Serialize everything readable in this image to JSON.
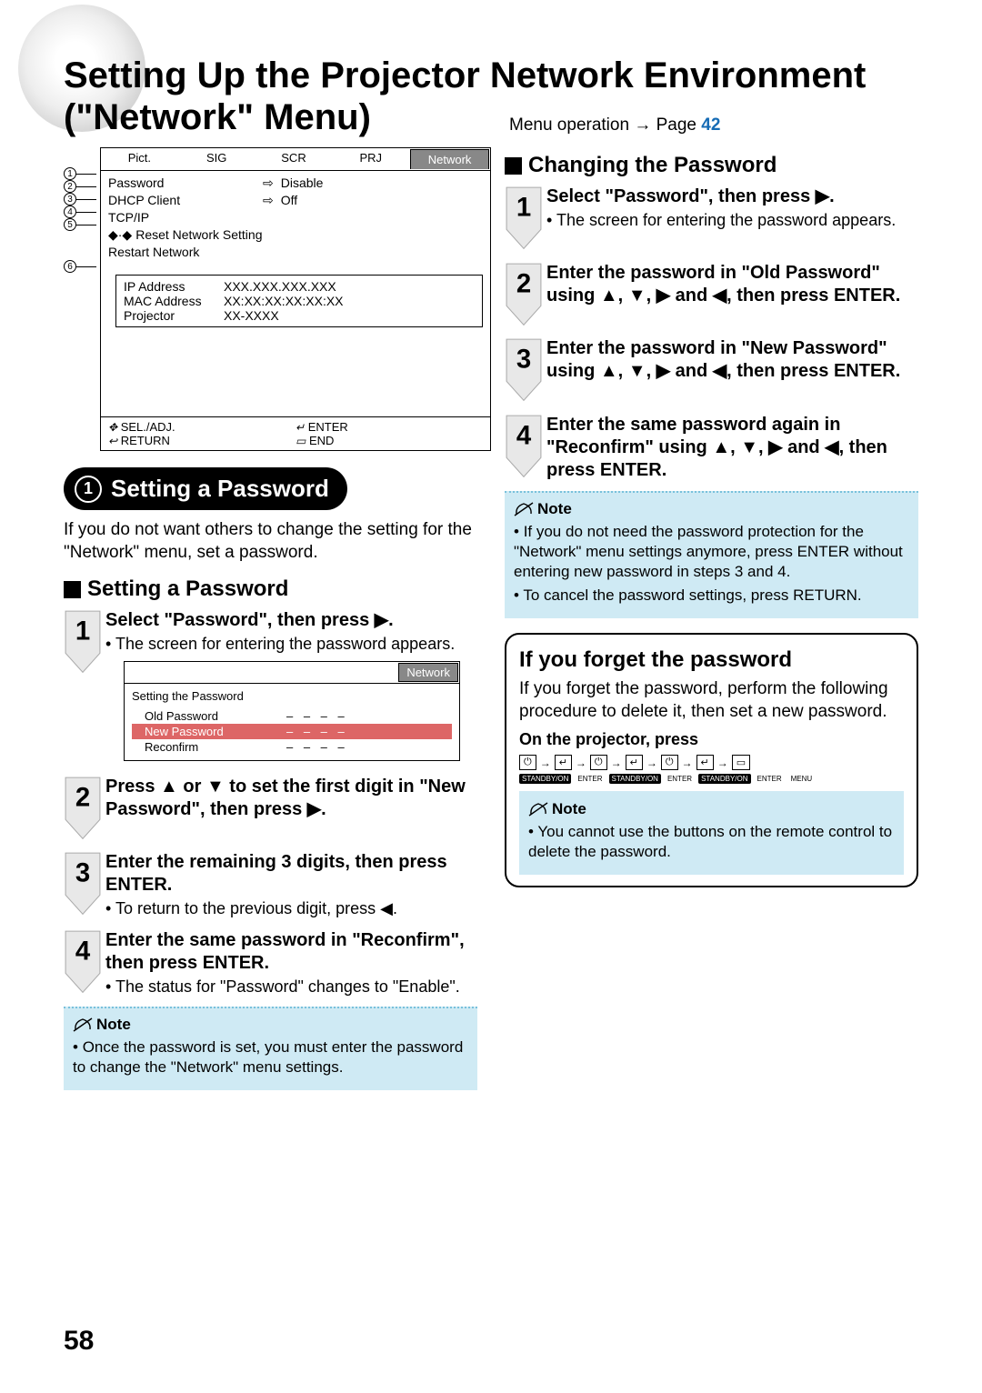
{
  "page": {
    "title": "Setting Up the Projector Network Environment (\"Network\" Menu)",
    "menu_op_prefix": "Menu operation ",
    "menu_op_page": "Page ",
    "menu_op_num": "42",
    "number": "58"
  },
  "osd": {
    "tabs": [
      "Pict.",
      "SIG",
      "SCR",
      "PRJ",
      "Network"
    ],
    "rows": [
      {
        "label": "Password",
        "value": "Disable"
      },
      {
        "label": "DHCP Client",
        "value": "Off"
      },
      {
        "label": "TCP/IP",
        "value": ""
      },
      {
        "label": "Reset Network Setting",
        "value": ""
      },
      {
        "label": "Restart Network",
        "value": ""
      }
    ],
    "info": [
      {
        "k": "IP Address",
        "v": "XXX.XXX.XXX.XXX"
      },
      {
        "k": "MAC Address",
        "v": "XX:XX:XX:XX:XX:XX"
      },
      {
        "k": "Projector",
        "v": "XX-XXXX"
      }
    ],
    "foot": {
      "sel": "SEL./ADJ.",
      "enter": "ENTER",
      "return": "RETURN",
      "end": "END"
    },
    "callouts": [
      "1",
      "2",
      "3",
      "4",
      "5",
      "6"
    ]
  },
  "section1": {
    "pill_num": "1",
    "pill_title": "Setting a Password",
    "intro": "If you do not want others to change the setting for the \"Network\" menu, set a password.",
    "sub": "Setting a Password",
    "steps": [
      {
        "n": "1",
        "hd": "Select \"Password\", then press ▶.",
        "body": "The screen for entering the password appears."
      },
      {
        "n": "2",
        "hd": "Press ▲ or ▼ to set the first digit in \"New Password\", then press ▶.",
        "body": ""
      },
      {
        "n": "3",
        "hd": "Enter the remaining 3 digits, then press ENTER.",
        "body": "To return to the previous digit, press ◀."
      },
      {
        "n": "4",
        "hd": "Enter the same password in \"Reconfirm\", then press ENTER.",
        "body": "The status for \"Password\" changes to \"Enable\"."
      }
    ],
    "pw_osd": {
      "tab": "Network",
      "title": "Setting the Password",
      "rows": [
        {
          "k": "Old Password",
          "v": "– – – –",
          "sel": false
        },
        {
          "k": "New Password",
          "v": "–  – – –",
          "sel": true
        },
        {
          "k": "Reconfirm",
          "v": "– – – –",
          "sel": false
        }
      ]
    },
    "note_label": "Note",
    "note": "Once the password is set, you must enter the password to change the \"Network\" menu settings."
  },
  "section2": {
    "sub": "Changing the Password",
    "steps": [
      {
        "n": "1",
        "hd": "Select \"Password\", then press ▶.",
        "body": "The screen for entering the password appears."
      },
      {
        "n": "2",
        "hd": "Enter the password in \"Old Password\" using ▲, ▼, ▶ and ◀, then press ENTER.",
        "body": ""
      },
      {
        "n": "3",
        "hd": "Enter the password in \"New Password\" using ▲, ▼, ▶ and ◀, then press ENTER.",
        "body": ""
      },
      {
        "n": "4",
        "hd": "Enter the same password again in \"Reconfirm\" using ▲, ▼, ▶ and ◀, then press ENTER.",
        "body": ""
      }
    ],
    "note_label": "Note",
    "notes": [
      "If you do not need the password protection for the \"Network\" menu settings anymore, press ENTER without entering new password in steps 3 and 4.",
      "To cancel the password settings, press RETURN."
    ]
  },
  "forget": {
    "title": "If you forget the password",
    "p": "If you forget the password, perform the following procedure to delete it, then set a new password.",
    "on_proj": "On the projector, press",
    "seq_buttons": [
      "⏻",
      "↵",
      "⏻",
      "↵",
      "⏻",
      "↵",
      "▭"
    ],
    "seq_labels": [
      "STANDBY/ON",
      "ENTER",
      "STANDBY/ON",
      "ENTER",
      "STANDBY/ON",
      "ENTER",
      "MENU"
    ],
    "note_label": "Note",
    "note": "You cannot use the buttons on the remote control to delete the password."
  }
}
